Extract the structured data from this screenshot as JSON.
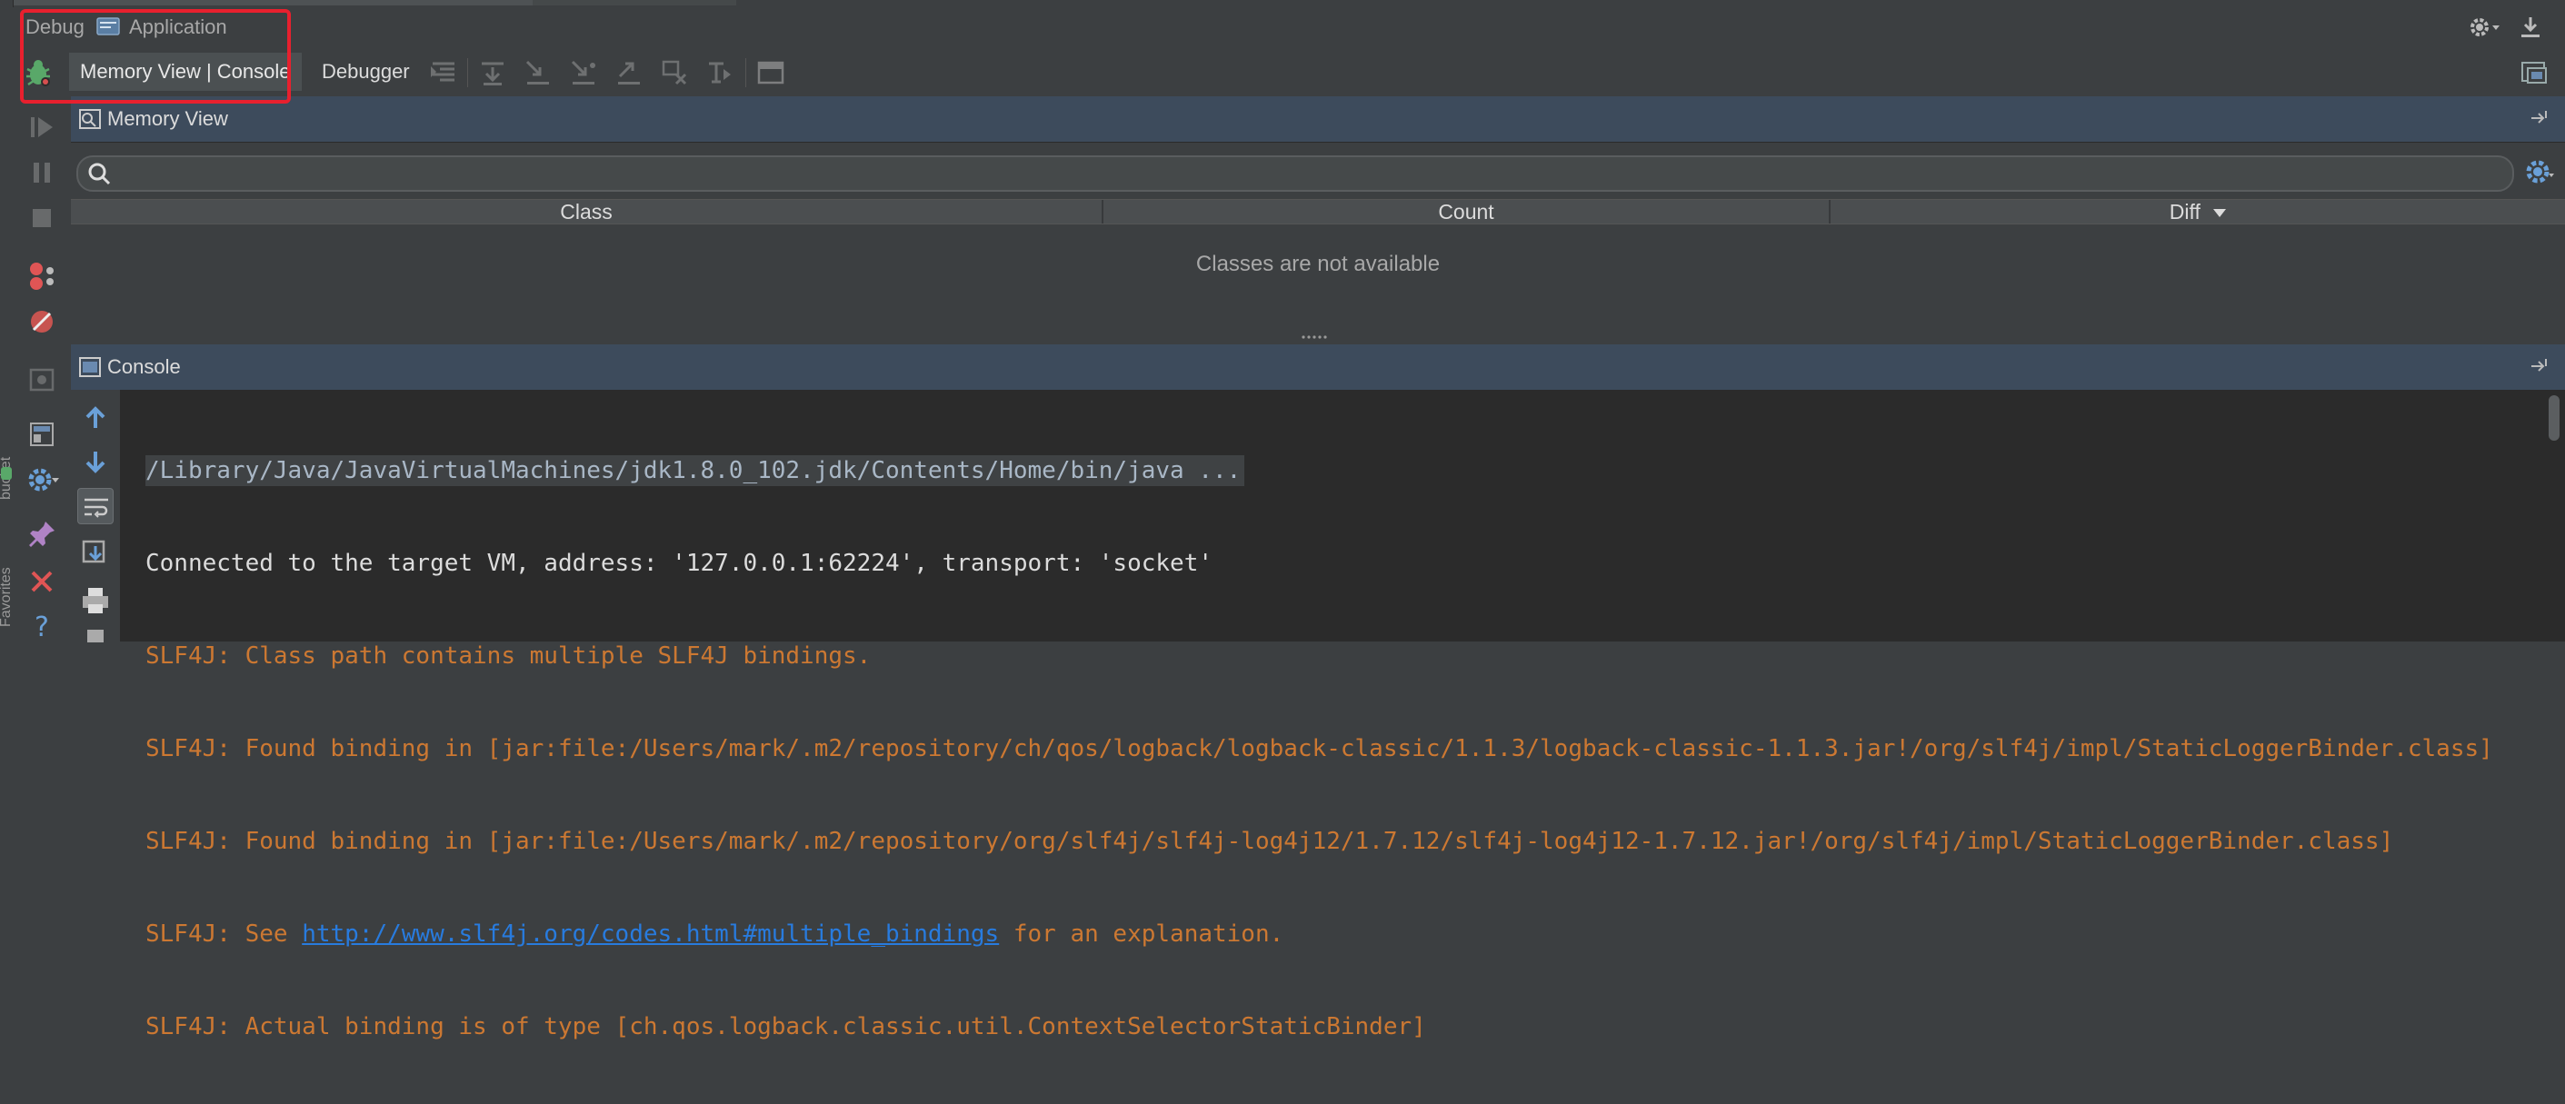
{
  "header": {
    "debug_label": "Debug",
    "config_name": "Application"
  },
  "tabs": [
    {
      "label": "Memory View | Console",
      "active": true
    },
    {
      "label": "Debugger",
      "active": false
    }
  ],
  "memory_view": {
    "title": "Memory View",
    "search": {
      "value": "",
      "placeholder": ""
    },
    "columns": [
      "Class",
      "Count",
      "Diff"
    ],
    "empty_message": "Classes are not available"
  },
  "console": {
    "title": "Console",
    "lines": {
      "cmd": "/Library/Java/JavaVirtualMachines/jdk1.8.0_102.jdk/Contents/Home/bin/java ...",
      "connected": "Connected to the target VM, address: '127.0.0.1:62224', transport: 'socket'",
      "slf1": "SLF4J: Class path contains multiple SLF4J bindings.",
      "slf2": "SLF4J: Found binding in [jar:file:/Users/mark/.m2/repository/ch/qos/logback/logback-classic/1.1.3/logback-classic-1.1.3.jar!/org/slf4j/impl/StaticLoggerBinder.class]",
      "slf3": "SLF4J: Found binding in [jar:file:/Users/mark/.m2/repository/org/slf4j/slf4j-log4j12/1.7.12/slf4j-log4j12-1.7.12.jar!/org/slf4j/impl/StaticLoggerBinder.class]",
      "slf4_prefix": "SLF4J: See ",
      "slf4_link": "http://www.slf4j.org/codes.html#multiple_bindings",
      "slf4_suffix": " for an explanation.",
      "slf5": "SLF4J: Actual binding is of type [ch.qos.logback.classic.util.ContextSelectorStaticBinder]"
    }
  },
  "left_strip": {
    "label_upper": "bucket",
    "label_lower": "Favorites"
  },
  "colors": {
    "highlight": "#e8202e",
    "error_text": "#cc7832",
    "link": "#287bde",
    "panel_header": "#3d4b5c",
    "bug_green": "#59a869"
  },
  "icons": {
    "debug": "bug-icon",
    "settings": "gear-icon",
    "hide": "minimize-icon",
    "restore": "restore-layout-icon",
    "search": "search-icon"
  }
}
